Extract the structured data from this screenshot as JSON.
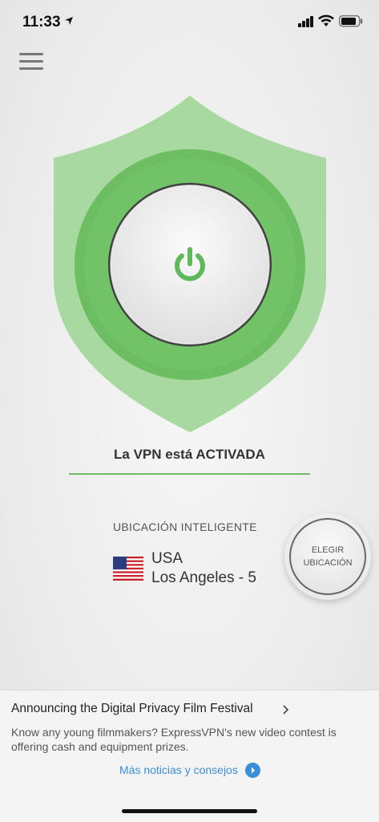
{
  "status_bar": {
    "time": "11:33"
  },
  "vpn": {
    "status_text": "La VPN está ACTIVADA"
  },
  "location": {
    "smart_label": "UBICACIÓN INTELIGENTE",
    "country": "USA",
    "city": "Los Angeles - 5",
    "choose_line1": "ELEGIR",
    "choose_line2": "UBICACIÓN"
  },
  "news": {
    "title": "Announcing the Digital Privacy Film Festival",
    "body": "Know any young filmmakers? ExpressVPN's new video contest is offering cash and equipment prizes.",
    "more_link": "Más noticias y consejos"
  },
  "colors": {
    "shield_light": "#a8d9a0",
    "ring_green": "#6dbe63",
    "power_icon": "#5fb859",
    "link_blue": "#3a8fd9"
  },
  "icons": [
    "location-arrow-icon",
    "signal-icon",
    "wifi-icon",
    "battery-icon",
    "menu-icon",
    "power-icon",
    "us-flag-icon",
    "chevron-right-icon",
    "arrow-right-circle-icon"
  ]
}
